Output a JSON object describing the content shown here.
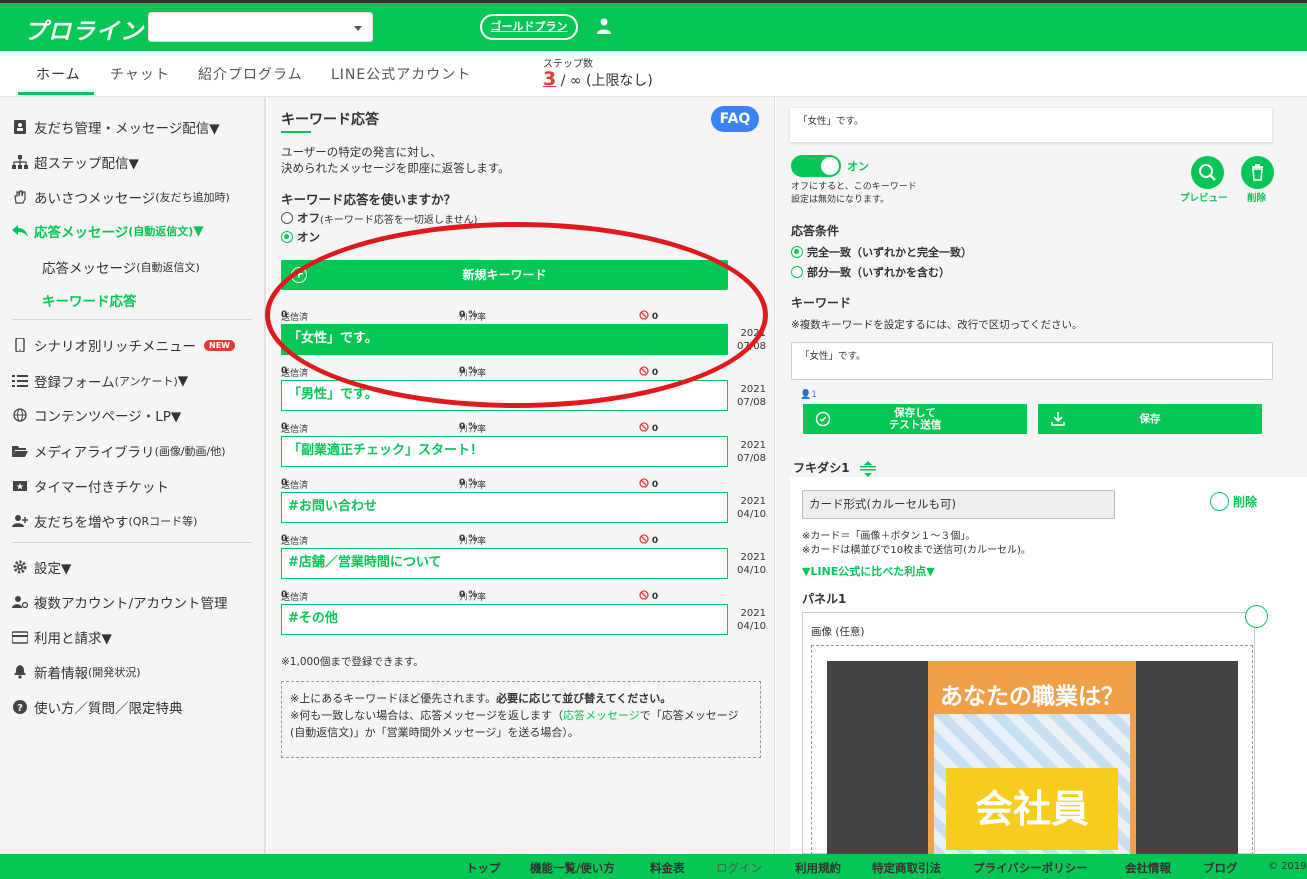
{
  "header": {
    "logo": "プロライン",
    "account_select_value": "",
    "plan_button": "ゴールドプラン"
  },
  "nav": {
    "tabs": [
      "ホーム",
      "チャット",
      "紹介プログラム",
      "LINE公式アカウント"
    ],
    "steps_label": "ステップ数",
    "steps_current": "3",
    "steps_limit": "/ ∞ (上限なし)"
  },
  "sidebar": {
    "items": [
      {
        "label": "友だち管理・メッセージ配信▼"
      },
      {
        "label": "超ステップ配信▼"
      },
      {
        "label": "あいさつメッセージ",
        "sub": "(友だち追加時)"
      },
      {
        "label": "応答メッセージ",
        "sub": "(自動返信文)",
        "suffix": "▼"
      },
      {
        "label": "応答メッセージ",
        "sub": "(自動返信文)"
      },
      {
        "label": "キーワード応答"
      },
      {
        "label": "シナリオ別リッチメニュー",
        "badge": "NEW"
      },
      {
        "label": "登録フォーム",
        "sub": "(アンケート)",
        "suffix": "▼"
      },
      {
        "label": "コンテンツページ・LP▼"
      },
      {
        "label": "メディアライブラリ",
        "sub": "(画像/動画/他)"
      },
      {
        "label": "タイマー付きチケット"
      },
      {
        "label": "友だちを増やす",
        "sub": "(QRコード等)"
      },
      {
        "label": "設定▼"
      },
      {
        "label": "複数アカウント/アカウント管理"
      },
      {
        "label": "利用と請求▼"
      },
      {
        "label": "新着情報",
        "sub": "(開発状況)"
      },
      {
        "label": "使い方／質問／限定特典"
      }
    ]
  },
  "keyword": {
    "title": "キーワード応答",
    "faq": "FAQ",
    "desc_line1": "ユーザーの特定の発言に対し、",
    "desc_line2": "決められたメッセージを即座に返答します。",
    "question": "キーワード応答を使いますか？",
    "off_label": "オフ",
    "off_note": "(キーワード応答を一切返しません)",
    "on_label": "オン",
    "new_button": "新規キーワード",
    "stat_sent": "送信済",
    "stat_click": "ｸﾘｯｸ率",
    "rows": [
      {
        "keyword": "「女性」です。",
        "sent": "0",
        "click": "0 %",
        "block": "0",
        "year": "2021",
        "date": "07/08"
      },
      {
        "keyword": "「男性」です。",
        "sent": "0",
        "click": "0 %",
        "block": "0",
        "year": "2021",
        "date": "07/08"
      },
      {
        "keyword": "「副業適正チェック」スタート！",
        "sent": "0",
        "click": "0 %",
        "block": "0",
        "year": "2021",
        "date": "07/08"
      },
      {
        "keyword": "#お問い合わせ",
        "sent": "0",
        "click": "0 %",
        "block": "0",
        "year": "2021",
        "date": "04/10"
      },
      {
        "keyword": "#店舗／営業時間について",
        "sent": "0",
        "click": "0 %",
        "block": "0",
        "year": "2021",
        "date": "04/10"
      },
      {
        "keyword": "#その他",
        "sent": "0",
        "click": "0 %",
        "block": "0",
        "year": "2021",
        "date": "04/10"
      }
    ],
    "limit_note": "※1,000個まで登録できます。",
    "priority_note": "※上にあるキーワードほど優先されます。",
    "priority_note_bold": "必要に応じて並び替えてください。",
    "fallback_note_a": "※何も一致しない場合は、応答メッセージを返します（",
    "fallback_link": "応答メッセージ",
    "fallback_note_b": "で「応答メッセージ(自動返信文)」か「営業時間外メッセージ」を送る場合）。"
  },
  "detail": {
    "message_preview": "「女性」です。",
    "toggle_label": "オン",
    "toggle_note_1": "オフにすると、このキーワード",
    "toggle_note_2": "設定は無効になります。",
    "preview_label": "プレビュー",
    "delete_label": "削除",
    "condition_title": "応答条件",
    "condition_exact": "完全一致（いずれかと完全一致）",
    "condition_partial": "部分一致（いずれかを含む）",
    "keyword_title": "キーワード",
    "keyword_note": "※複数キーワードを設定するには、改行で区切ってください。",
    "keyword_value": "「女性」です。",
    "count": "1",
    "save_test_line1": "保存して",
    "save_test_line2": "テスト送信",
    "save": "保存",
    "fukidashi": "フキダシ1",
    "card_select_value": "カード形式(カルーセルも可)",
    "card_delete": "削除",
    "card_note_1": "※カード＝「画像＋ボタン１～３個」。",
    "card_note_2": "※カードは横並びで10枚まで送信可(カルーセル)。",
    "card_merit": "▼LINE公式に比べた利点▼",
    "panel_title": "パネル1",
    "image_label": "画像 (任意)",
    "image_question": "あなたの職業は？",
    "image_answer": "会社員"
  },
  "footer": {
    "links": [
      "トップ",
      "機能一覧/使い方",
      "料金表",
      "ログイン",
      "利用規約",
      "特定商取引法",
      "プライバシーポリシー",
      "会社情報",
      "ブログ"
    ],
    "copyright": "© 2019"
  },
  "colors": {
    "brand": "#06c755",
    "alert": "#e53935",
    "faq": "#3b82f6"
  }
}
